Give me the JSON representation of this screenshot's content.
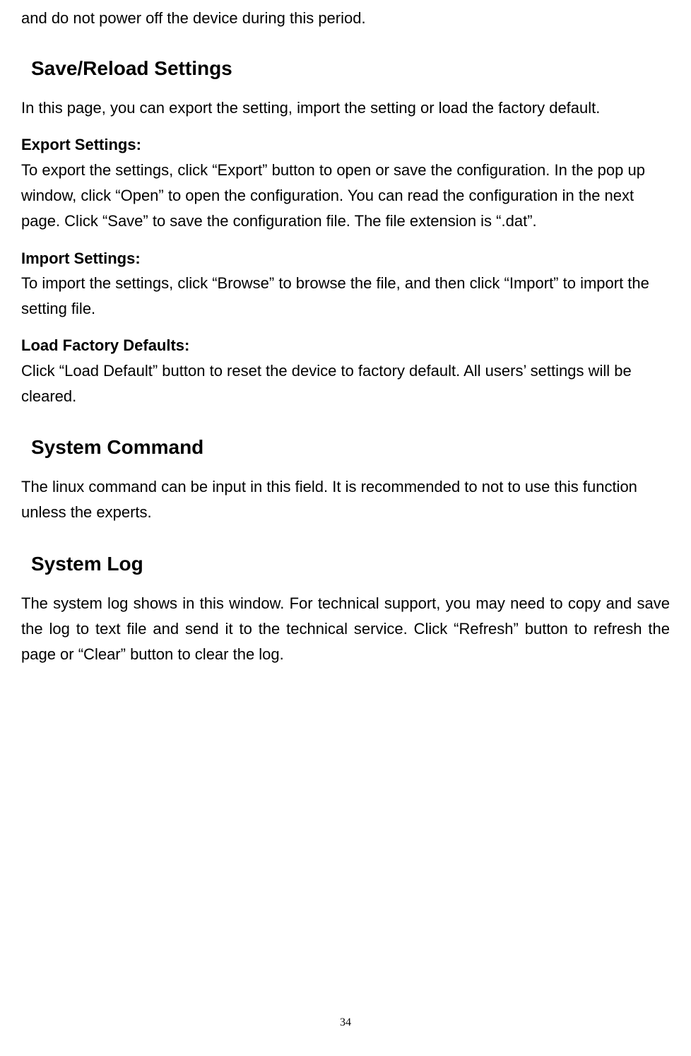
{
  "fragment": "and do not power off the device during this period.",
  "sections": {
    "save_reload": {
      "heading": "Save/Reload Settings",
      "intro": "In this page, you can export the setting, import the setting or load the factory default.",
      "export": {
        "title": "Export Settings:",
        "body": "To export the settings, click “Export” button to open or save the configuration. In the pop up window, click “Open” to open the configuration. You can read the configuration in the next page. Click “Save” to save the configuration file. The file extension is “.dat”."
      },
      "import": {
        "title": "Import Settings:",
        "body": "To import the settings, click “Browse” to browse the file, and then click “Import” to import the setting file."
      },
      "load_defaults": {
        "title": "Load Factory Defaults:",
        "body": "Click “Load Default” button to reset the device to factory default. All users’ settings will be cleared."
      }
    },
    "system_command": {
      "heading": "System Command",
      "body": "The linux command can be input in this field. It is recommended to not to use this function unless the experts."
    },
    "system_log": {
      "heading": "System Log",
      "body": "The system log shows in this window. For technical support, you may need to copy and save the log to text file and send it to the technical service. Click “Refresh” button to refresh the page or “Clear” button to clear the log."
    }
  },
  "page_number": "34"
}
